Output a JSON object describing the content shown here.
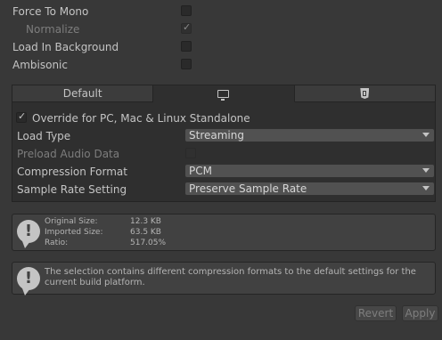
{
  "top_settings": {
    "force_to_mono": {
      "label": "Force To Mono",
      "checked": false
    },
    "normalize": {
      "label": "Normalize",
      "checked": true,
      "enabled": false
    },
    "load_in_background": {
      "label": "Load In Background",
      "checked": false
    },
    "ambisonic": {
      "label": "Ambisonic",
      "checked": false
    }
  },
  "platform_tabs": [
    {
      "label": "Default",
      "icon": null,
      "active": false
    },
    {
      "label": "",
      "icon": "monitor-icon",
      "active": true
    },
    {
      "label": "",
      "icon": "html5-icon",
      "active": false
    }
  ],
  "platform_settings": {
    "override": {
      "label": "Override for PC, Mac & Linux Standalone",
      "checked": true
    },
    "load_type": {
      "label": "Load Type",
      "value": "Streaming"
    },
    "preload_audio_data": {
      "label": "Preload Audio Data",
      "checked": false,
      "enabled": false
    },
    "compression_format": {
      "label": "Compression Format",
      "value": "PCM"
    },
    "sample_rate_setting": {
      "label": "Sample Rate Setting",
      "value": "Preserve Sample Rate"
    }
  },
  "size_info": {
    "icon": "warning-icon",
    "original_size_label": "Original Size:",
    "original_size_value": "12.3 KB",
    "imported_size_label": "Imported Size:",
    "imported_size_value": "63.5 KB",
    "ratio_label": "Ratio:",
    "ratio_value": "517.05%"
  },
  "compression_warning": {
    "icon": "warning-icon",
    "text": "The selection contains different compression formats to the default settings for the current build platform."
  },
  "actions": {
    "revert_label": "Revert",
    "apply_label": "Apply"
  }
}
